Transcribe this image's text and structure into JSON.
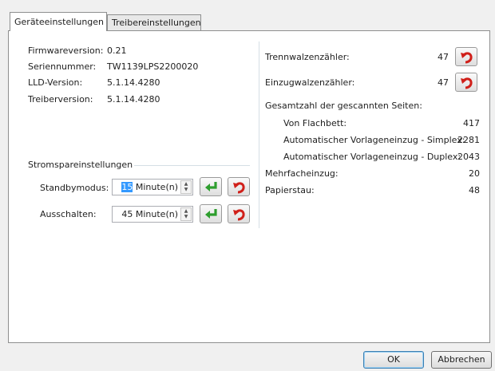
{
  "tabs": [
    {
      "label": "Geräteeinstellungen"
    },
    {
      "label": "Treibereinstellungen"
    }
  ],
  "device_info": [
    {
      "label": "Firmwareversion:",
      "value": "0.21"
    },
    {
      "label": "Seriennummer:",
      "value": "TW1139LPS2200020"
    },
    {
      "label": "LLD-Version:",
      "value": "5.1.14.4280"
    },
    {
      "label": "Treiberversion:",
      "value": "5.1.14.4280"
    }
  ],
  "power": {
    "group_title": "Stromspareinstellungen",
    "standby": {
      "label": "Standbymodus:",
      "value_selected": "15",
      "value_rest": " Minute(n)"
    },
    "off": {
      "label": "Ausschalten:",
      "value": "45 Minute(n)"
    }
  },
  "counters": {
    "separation_roller": {
      "label": "Trennwalzenzähler:",
      "value": "47"
    },
    "feed_roller": {
      "label": "Einzugwalzenzähler:",
      "value": "47"
    },
    "total_label": "Gesamtzahl der gescannten Seiten:",
    "flatbed": {
      "label": "Von Flachbett:",
      "value": "417"
    },
    "adf_simplex": {
      "label": "Automatischer Vorlageneinzug - Simplex:",
      "value": "2281"
    },
    "adf_duplex": {
      "label": "Automatischer Vorlageneinzug - Duplex:",
      "value": "2043"
    },
    "multifeed": {
      "label": "Mehrfacheinzug:",
      "value": "20"
    },
    "paper_jam": {
      "label": "Papierstau:",
      "value": "48"
    }
  },
  "footer": {
    "ok_label": "OK",
    "cancel_label": "Abbrechen"
  },
  "icons": {
    "apply": "green-enter-arrow-icon",
    "reset": "red-undo-arrow-icon"
  },
  "colors": {
    "apply_green": "#2e9e2e",
    "reset_red": "#d0201a",
    "selection": "#3399ff"
  }
}
